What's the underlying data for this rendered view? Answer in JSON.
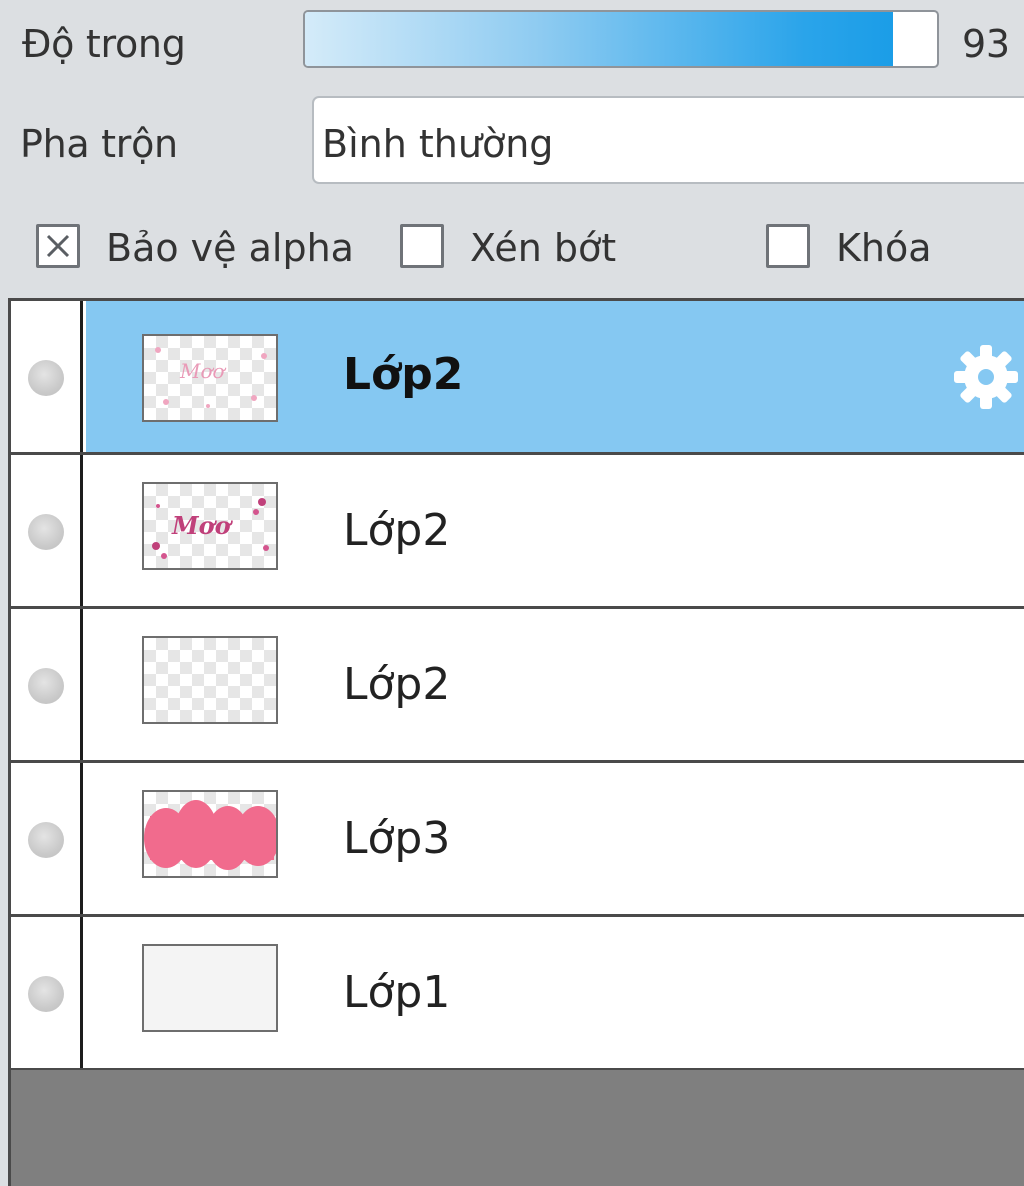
{
  "opacity": {
    "label": "Độ trong",
    "value": "93",
    "level_percent": 93,
    "fill_color_start": "#d4ebf9",
    "fill_color_end": "#1b9de7"
  },
  "blend": {
    "label": "Pha trộn",
    "value": "Bình thường"
  },
  "options": {
    "protect_alpha": {
      "label": "Bảo vệ alpha",
      "checked": true
    },
    "clipping": {
      "label": "Xén bớt",
      "checked": false
    },
    "lock": {
      "label": "Khóa",
      "checked": false
    }
  },
  "layers": [
    {
      "name": "Lớp2",
      "selected": true,
      "thumb_icon": "pink-text-sketch-thumbnail",
      "settings_icon": "gear-icon"
    },
    {
      "name": "Lớp2",
      "selected": false,
      "thumb_icon": "magenta-text-thumbnail"
    },
    {
      "name": "Lớp2",
      "selected": false,
      "thumb_icon": "empty-transparent-thumbnail"
    },
    {
      "name": "Lớp3",
      "selected": false,
      "thumb_icon": "pink-blob-thumbnail"
    },
    {
      "name": "Lớp1",
      "selected": false,
      "thumb_icon": "white-paper-thumbnail"
    }
  ],
  "colors": {
    "selected_row": "#85c8f2",
    "panel_bg": "#dcdfe2",
    "empty_area": "#7f7f7f"
  }
}
